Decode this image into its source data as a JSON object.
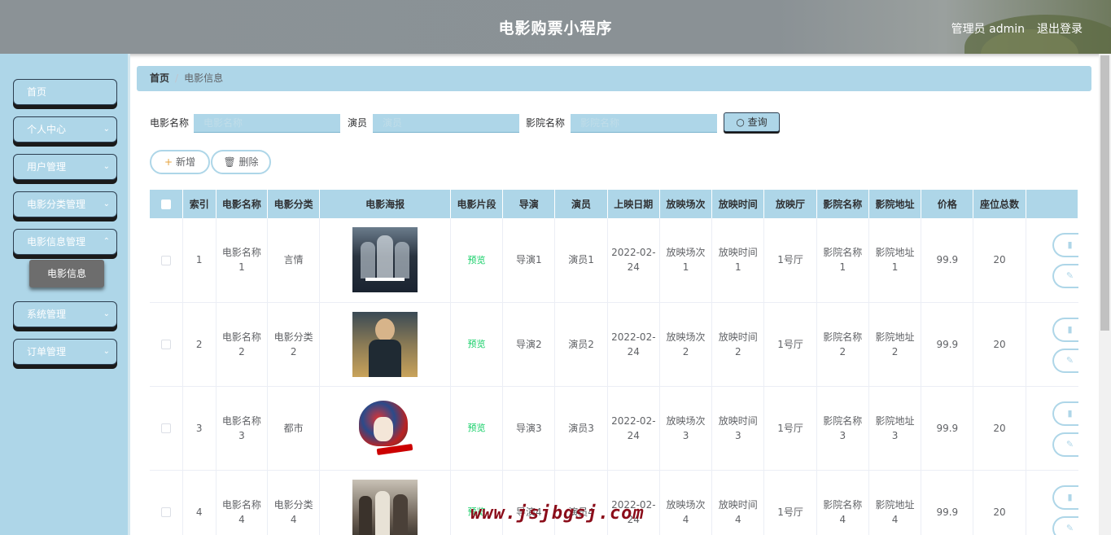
{
  "header": {
    "title": "电影购票小程序",
    "admin": "管理员 admin",
    "logout": "退出登录"
  },
  "sidebar": {
    "items": [
      {
        "label": "首页",
        "chevron": false
      },
      {
        "label": "个人中心",
        "chevron": true
      },
      {
        "label": "用户管理",
        "chevron": true
      },
      {
        "label": "电影分类管理",
        "chevron": true
      },
      {
        "label": "电影信息管理",
        "chevron": true
      },
      {
        "label": "系统管理",
        "chevron": true
      },
      {
        "label": "订单管理",
        "chevron": true
      }
    ],
    "sub_item": "电影信息"
  },
  "breadcrumb": {
    "home": "首页",
    "separator": "/",
    "current": "电影信息"
  },
  "search": {
    "movie_name_label": "电影名称",
    "movie_name_placeholder": "电影名称",
    "actor_label": "演员",
    "actor_placeholder": "演员",
    "cinema_label": "影院名称",
    "cinema_placeholder": "影院名称",
    "query_button": "查询"
  },
  "actions": {
    "add": "新增",
    "delete": "删除"
  },
  "table": {
    "headers": [
      "索引",
      "电影名称",
      "电影分类",
      "电影海报",
      "电影片段",
      "导演",
      "演员",
      "上映日期",
      "放映场次",
      "放映时间",
      "放映厅",
      "影院名称",
      "影院地址",
      "价格",
      "座位总数"
    ],
    "preview_label": "预览",
    "rows": [
      {
        "index": "1",
        "name": "电影名称1",
        "category": "言情",
        "director": "导演1",
        "actor": "演员1",
        "date": "2022-02-24",
        "session": "放映场次1",
        "time": "放映时间1",
        "hall": "1号厅",
        "cinema": "影院名称1",
        "address": "影院地址1",
        "price": "99.9",
        "seats": "20"
      },
      {
        "index": "2",
        "name": "电影名称2",
        "category": "电影分类2",
        "director": "导演2",
        "actor": "演员2",
        "date": "2022-02-24",
        "session": "放映场次2",
        "time": "放映时间2",
        "hall": "1号厅",
        "cinema": "影院名称2",
        "address": "影院地址2",
        "price": "99.9",
        "seats": "20"
      },
      {
        "index": "3",
        "name": "电影名称3",
        "category": "都市",
        "director": "导演3",
        "actor": "演员3",
        "date": "2022-02-24",
        "session": "放映场次3",
        "time": "放映时间3",
        "hall": "1号厅",
        "cinema": "影院名称3",
        "address": "影院地址3",
        "price": "99.9",
        "seats": "20"
      },
      {
        "index": "4",
        "name": "电影名称4",
        "category": "电影分类4",
        "director": "导演4",
        "actor": "演员4",
        "date": "2022-02-24",
        "session": "放映场次4",
        "time": "放映时间4",
        "hall": "1号厅",
        "cinema": "影院名称4",
        "address": "影院地址4",
        "price": "99.9",
        "seats": "20"
      }
    ]
  },
  "watermark": "www.jsjbgsj.com",
  "colors": {
    "accent": "#aed6e8",
    "header": "#8b9296",
    "preview": "#13ce66"
  }
}
